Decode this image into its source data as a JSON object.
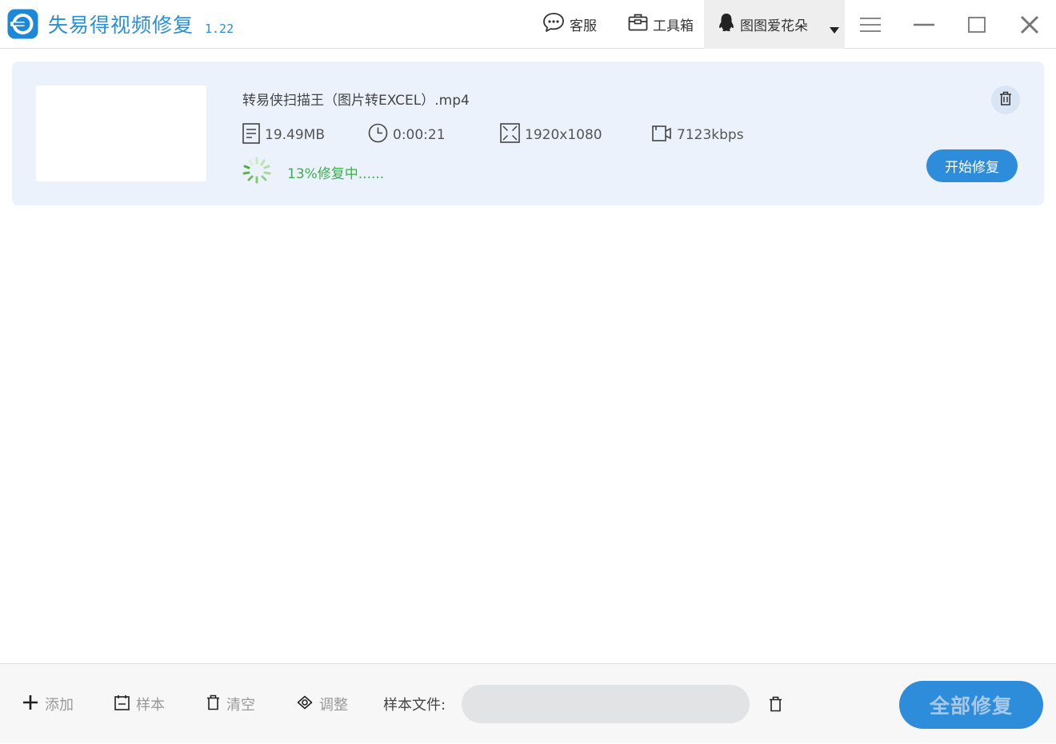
{
  "header": {
    "app_title": "失易得视频修复",
    "version": "1.22",
    "support_label": "客服",
    "toolbox_label": "工具箱",
    "user_name": "图图爱花朵"
  },
  "file": {
    "name": "转易侠扫描王（图片转EXCEL）.mp4",
    "size": "19.49MB",
    "duration": "0:00:21",
    "resolution": "1920x1080",
    "bitrate": "7123kbps",
    "progress_text": "13%修复中......",
    "progress_percent": 13,
    "start_button": "开始修复"
  },
  "footer": {
    "add_label": "添加",
    "sample_label": "样本",
    "clear_label": "清空",
    "adjust_label": "调整",
    "sample_file_label": "样本文件:",
    "sample_file_value": "",
    "repair_all_label": "全部修复"
  },
  "colors": {
    "accent": "#2d8ddb",
    "title_blue": "#2a8fd8",
    "progress_green": "#3bb04a",
    "card_bg": "#ebf2fc"
  },
  "icons": {
    "logo": "app-logo-icon",
    "support": "chat-bubble-icon",
    "toolbox": "briefcase-icon",
    "user": "penguin-icon",
    "dropdown": "caret-down-icon",
    "menu": "hamburger-icon",
    "minimize": "minimize-icon",
    "maximize": "maximize-icon",
    "close": "close-icon",
    "size": "document-icon",
    "duration": "clock-icon",
    "resolution": "resize-icon",
    "bitrate": "video-camera-icon",
    "progress": "spinner-icon",
    "delete": "trash-icon",
    "add": "plus-icon",
    "sample": "calendar-icon",
    "clear": "trash-icon",
    "adjust": "eye-icon"
  }
}
